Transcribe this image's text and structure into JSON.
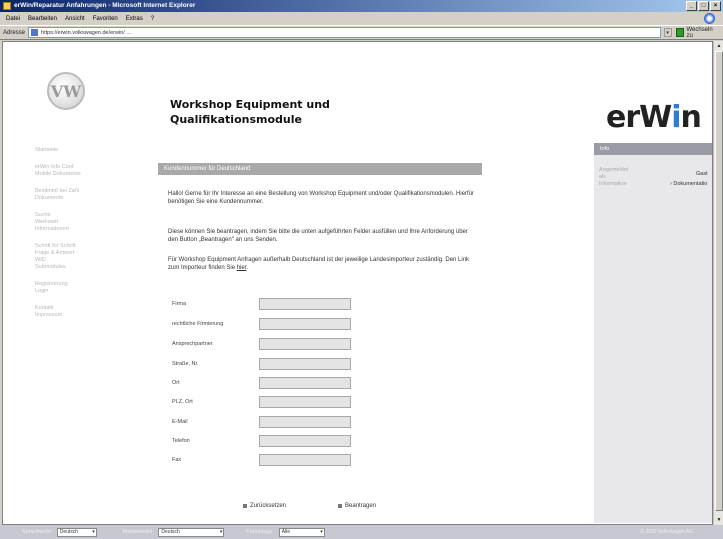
{
  "window": {
    "title": "erWin/Reparatur Anfahrungen - Microsoft Internet Explorer",
    "buttons": [
      "_",
      "□",
      "×"
    ]
  },
  "menubar": {
    "items": [
      "Datei",
      "Bearbeiten",
      "Ansicht",
      "Favoriten",
      "Extras",
      "?"
    ]
  },
  "addressbar": {
    "label": "Adresse",
    "url": "https://erwin.volkswagen.de/erwin/ ...",
    "go_label": "Wechseln zu"
  },
  "header": {
    "vw_logo_text": "VW",
    "title": "Workshop Equipment und\nQualifikationsmodule",
    "erwin_logo_pre": "erW",
    "erwin_logo_post": "n"
  },
  "leftnav": {
    "items": [
      "Startseite",
      "erWin Info Card\nMobile Dokumente",
      "Bestimmt bei Zahl\nDokumente",
      "Suche\nWerkstatt\nInformationen",
      "Schritt für Schritt\nFrage & Antwort\nWID\nSubmodules",
      "Registrierung\nLogin",
      "Kontakt\nImpressum"
    ]
  },
  "section": {
    "title": "Kundennummer für Deutschland"
  },
  "content": {
    "p1": "Hallo! Gerne für Ihr Interesse an eine Bestellung von Workshop Equipment und/oder Qualifikationsmodulen. Hierfür benötigen Sie eine Kundennummer.",
    "p2": "Diese können Sie beantragen, indem Sie bitte die unten aufgeführten Felder ausfüllen und Ihre Anforderung über den Button „Beantragen\" an uns Senden.",
    "p3_pre": "Für Workshop Equipment Anfragen außerhalb Deutschland ist der jeweilige Landesimporteur zuständig. Den Link zum Importeur finden Sie ",
    "p3_link": "hier"
  },
  "form": {
    "fields": [
      {
        "label": "Firma"
      },
      {
        "label": "rechtliche Firmierung"
      },
      {
        "label": "Ansprechpartner"
      },
      {
        "label": "Straße, Nr."
      },
      {
        "label": "Ort"
      },
      {
        "label": "PLZ, Ort"
      },
      {
        "label": "E-Mail"
      },
      {
        "label": "Telefon"
      },
      {
        "label": "Fax"
      }
    ],
    "back_label": "Zurücksetzen",
    "submit_label": "Beantragen"
  },
  "rightpanel": {
    "title": "Info",
    "row1_label": "Angemeldet\nals",
    "row1_value": "Gast",
    "row2_label": "Information",
    "row2_value": "Dokumentatio"
  },
  "footer": {
    "label1": "Sprachwahl",
    "select1": "Deutsch",
    "label2": "Markenwahl",
    "select2": "Deutsch",
    "label3": "Fahrzeuge",
    "select3": "Alle",
    "copyright": "© 2005 Volkswagen AG"
  }
}
